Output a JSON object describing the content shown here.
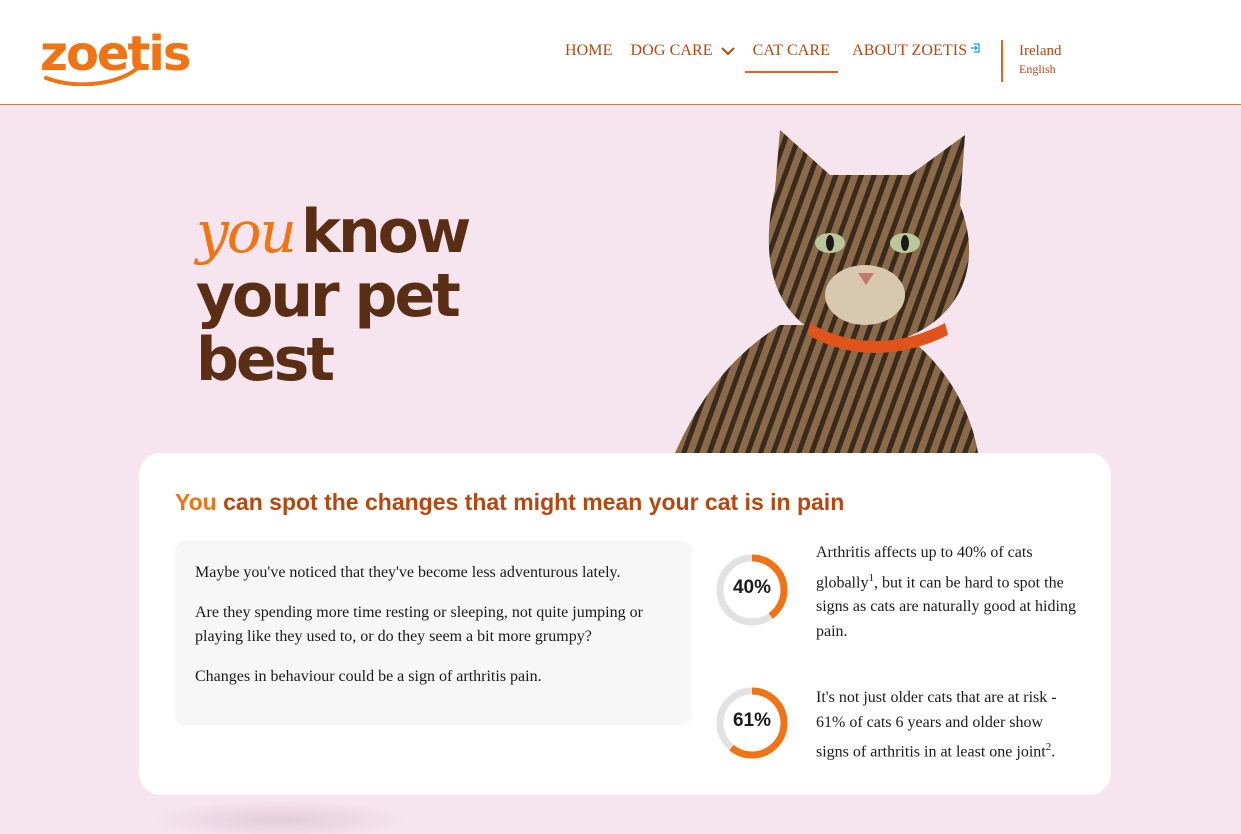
{
  "brand": {
    "logo_text": "zoetis",
    "accent_color": "#f07314",
    "brown_color": "#5a2e15",
    "nav_color": "#b8460d",
    "bg_color": "#f6e4ef"
  },
  "nav": {
    "items": [
      {
        "label": "HOME"
      },
      {
        "label": "DOG CARE",
        "icon": "chevron-down-icon"
      },
      {
        "label": "CAT CARE",
        "active": true
      },
      {
        "label": "ABOUT ZOETIS",
        "icon": "external-link-icon"
      }
    ],
    "region": {
      "country": "Ireland",
      "language": "English"
    }
  },
  "hero": {
    "title_accent": "you",
    "title_line1": "know",
    "title_line2": "your pet",
    "title_line3": "best",
    "image": "tabby-cat-with-orange-collar"
  },
  "card": {
    "title_accent": "You",
    "title_rest": "can spot the changes that might mean your cat is in pain",
    "paragraphs": [
      "Maybe you've noticed that they've become less adventurous lately.",
      "Are they spending more time resting or sleeping, not quite jumping or playing like they used to, or do they seem a bit more grumpy?",
      "Changes in behaviour could be a sign of arthritis pain."
    ],
    "stats": [
      {
        "value": 40,
        "label": "40%",
        "text_before": "Arthritis affects up to 40% of cats globally",
        "sup": "1",
        "text_after": ", but it can be hard to spot the signs as cats are naturally good at hiding pain."
      },
      {
        "value": 61,
        "label": "61%",
        "text_before": "It's not just older cats that are at risk - 61% of cats 6 years and older show signs of arthritis in at least one joint",
        "sup": "2",
        "text_after": "."
      }
    ]
  }
}
